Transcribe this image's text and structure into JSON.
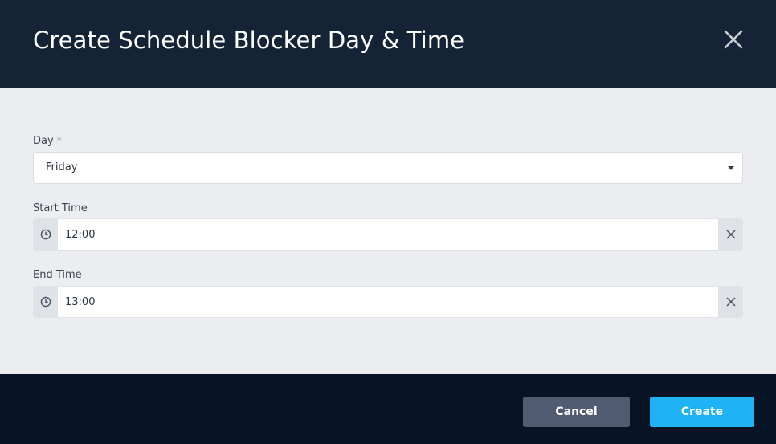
{
  "dialog": {
    "title": "Create Schedule Blocker Day & Time",
    "close_icon": "close-icon"
  },
  "form": {
    "day": {
      "label": "Day",
      "required_marker": "*",
      "value": "Friday",
      "icon": "chevron-down-icon"
    },
    "start_time": {
      "label": "Start Time",
      "value": "12:00",
      "icon": "clock-icon",
      "clear_icon": "clear-icon"
    },
    "end_time": {
      "label": "End Time",
      "value": "13:00",
      "icon": "clock-icon",
      "clear_icon": "clear-icon"
    }
  },
  "footer": {
    "cancel_label": "Cancel",
    "create_label": "Create"
  },
  "colors": {
    "header_bg": "#152336",
    "body_bg": "#ebedf1",
    "footer_bg": "#061426",
    "cancel_bg": "#515b72",
    "create_bg": "#1fb2f5"
  }
}
